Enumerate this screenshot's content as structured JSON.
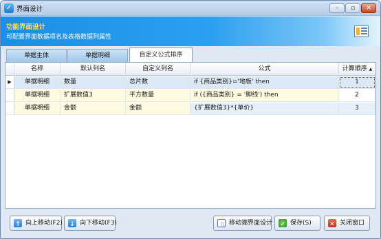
{
  "window": {
    "title": "界面设计",
    "min_glyph": "–",
    "max_glyph": "▫",
    "close_glyph": "✕"
  },
  "banner": {
    "title": "功能界面设计",
    "subtitle": "可配置界面数据项名及表格数据列属性"
  },
  "tabs": [
    {
      "label": "单据主体"
    },
    {
      "label": "单据明细"
    },
    {
      "label": "自定义公式排序"
    }
  ],
  "grid": {
    "columns": [
      "名称",
      "默认列名",
      "自定义列名",
      "公式",
      "计算顺序"
    ],
    "sort_indicator": "▲",
    "current_row_marker": "▶",
    "rows": [
      {
        "name": "单据明细",
        "default_col": "数量",
        "custom_col": "总片数",
        "formula": "if {商品类别}='地板' then",
        "order": "1"
      },
      {
        "name": "单据明细",
        "default_col": "扩展数值3",
        "custom_col": "平方数量",
        "formula": "if ({商品类别} = '脚线') then",
        "order": "2"
      },
      {
        "name": "单据明细",
        "default_col": "金额",
        "custom_col": "金额",
        "formula": "{扩展数值3}*{单价}",
        "order": "3"
      }
    ]
  },
  "buttons": {
    "move_up": "向上移动(F2)",
    "move_down": "向下移动(F3)",
    "mobile_design": "移动端界面设计",
    "save": "保存(S)",
    "close": "关闭窗口"
  },
  "colors": {
    "banner_title": "#ffe14a",
    "banner_bg": "#1b8fe4",
    "selected_row": "#dbe9f6"
  }
}
